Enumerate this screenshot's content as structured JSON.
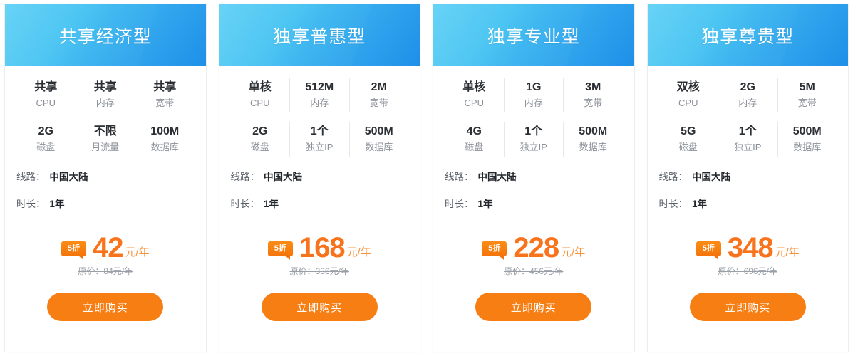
{
  "page": {
    "accent_blue_light": "#54cdf5",
    "accent_blue_dark": "#1e8fe8",
    "accent_orange": "#f77e13",
    "price_orange": "#f8731c"
  },
  "plans": [
    {
      "title": "共享经济型",
      "specs": [
        [
          {
            "value": "共享",
            "label": "CPU"
          },
          {
            "value": "共享",
            "label": "内存"
          },
          {
            "value": "共享",
            "label": "宽带"
          }
        ],
        [
          {
            "value": "2G",
            "label": "磁盘"
          },
          {
            "value": "不限",
            "label": "月流量"
          },
          {
            "value": "100M",
            "label": "数据库"
          }
        ]
      ],
      "attributes": [
        {
          "key": "线路：",
          "value": "中国大陆"
        },
        {
          "key": "时长：",
          "value": "1年"
        }
      ],
      "discount_badge": "5折",
      "price": "42",
      "price_unit": "元/年",
      "original_price": "原价：84元/年",
      "buy_label": "立即购买"
    },
    {
      "title": "独享普惠型",
      "specs": [
        [
          {
            "value": "单核",
            "label": "CPU"
          },
          {
            "value": "512M",
            "label": "内存"
          },
          {
            "value": "2M",
            "label": "宽带"
          }
        ],
        [
          {
            "value": "2G",
            "label": "磁盘"
          },
          {
            "value": "1个",
            "label": "独立IP"
          },
          {
            "value": "500M",
            "label": "数据库"
          }
        ]
      ],
      "attributes": [
        {
          "key": "线路：",
          "value": "中国大陆"
        },
        {
          "key": "时长：",
          "value": "1年"
        }
      ],
      "discount_badge": "5折",
      "price": "168",
      "price_unit": "元/年",
      "original_price": "原价：336元/年",
      "buy_label": "立即购买"
    },
    {
      "title": "独享专业型",
      "specs": [
        [
          {
            "value": "单核",
            "label": "CPU"
          },
          {
            "value": "1G",
            "label": "内存"
          },
          {
            "value": "3M",
            "label": "宽带"
          }
        ],
        [
          {
            "value": "4G",
            "label": "磁盘"
          },
          {
            "value": "1个",
            "label": "独立IP"
          },
          {
            "value": "500M",
            "label": "数据库"
          }
        ]
      ],
      "attributes": [
        {
          "key": "线路：",
          "value": "中国大陆"
        },
        {
          "key": "时长：",
          "value": "1年"
        }
      ],
      "discount_badge": "5折",
      "price": "228",
      "price_unit": "元/年",
      "original_price": "原价：456元/年",
      "buy_label": "立即购买"
    },
    {
      "title": "独享尊贵型",
      "specs": [
        [
          {
            "value": "双核",
            "label": "CPU"
          },
          {
            "value": "2G",
            "label": "内存"
          },
          {
            "value": "5M",
            "label": "宽带"
          }
        ],
        [
          {
            "value": "5G",
            "label": "磁盘"
          },
          {
            "value": "1个",
            "label": "独立IP"
          },
          {
            "value": "500M",
            "label": "数据库"
          }
        ]
      ],
      "attributes": [
        {
          "key": "线路：",
          "value": "中国大陆"
        },
        {
          "key": "时长：",
          "value": "1年"
        }
      ],
      "discount_badge": "5折",
      "price": "348",
      "price_unit": "元/年",
      "original_price": "原价：696元/年",
      "buy_label": "立即购买"
    }
  ]
}
